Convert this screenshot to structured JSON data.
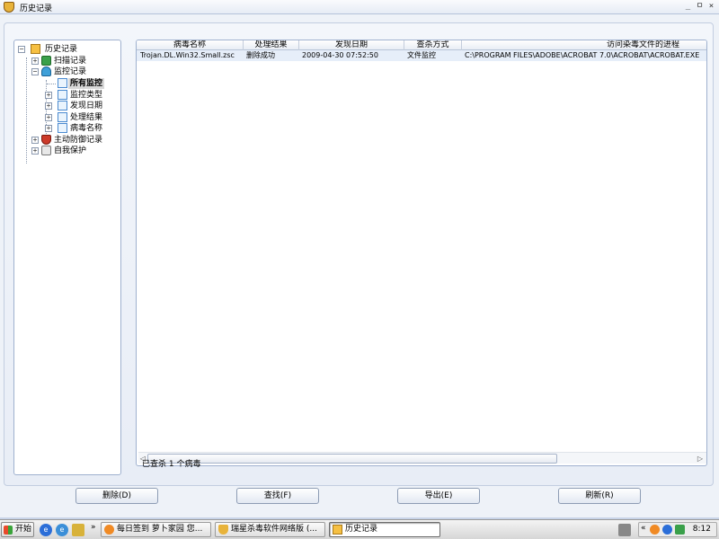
{
  "window": {
    "title": "历史记录",
    "controls": {
      "minimize": "_",
      "restore": "ㅁ",
      "close": "×"
    }
  },
  "tree": {
    "root": {
      "label": "历史记录",
      "expander": "−"
    },
    "items": [
      {
        "label": "扫描记录",
        "expander": "+"
      },
      {
        "label": "监控记录",
        "expander": "−"
      },
      {
        "label": "所有监控",
        "expander": ""
      },
      {
        "label": "监控类型",
        "expander": "+"
      },
      {
        "label": "发现日期",
        "expander": "+"
      },
      {
        "label": "处理结果",
        "expander": "+"
      },
      {
        "label": "病毒名称",
        "expander": "+"
      },
      {
        "label": "主动防御记录",
        "expander": "+"
      },
      {
        "label": "自我保护",
        "expander": "+"
      }
    ]
  },
  "table": {
    "columns": [
      "病毒名称",
      "处理结果",
      "发现日期",
      "查杀方式",
      "访问染毒文件的进程"
    ],
    "rows": [
      [
        "Trojan.DL.Win32.Small.zsc",
        "删除成功",
        "2009-04-30 07:52:50",
        "文件监控",
        "C:\\PROGRAM FILES\\ADOBE\\ACROBAT 7.0\\ACROBAT\\ACROBAT.EXE"
      ]
    ]
  },
  "status": "已查杀 1 个病毒",
  "buttons": {
    "delete": "删除(D)",
    "find": "查找(F)",
    "export": "导出(E)",
    "refresh": "刷新(R)"
  },
  "taskbar": {
    "start": "开始",
    "overflow": "»",
    "tasks": [
      "每日签到 萝卜家园 您...",
      "瑞星杀毒软件网络版 (...",
      "历史记录"
    ],
    "tray_overflow": "«",
    "clock": "8:12"
  },
  "colors": {
    "accent": "#3fa0d8",
    "selected_row": "#e6eef9",
    "border": "#9fb1cf"
  }
}
